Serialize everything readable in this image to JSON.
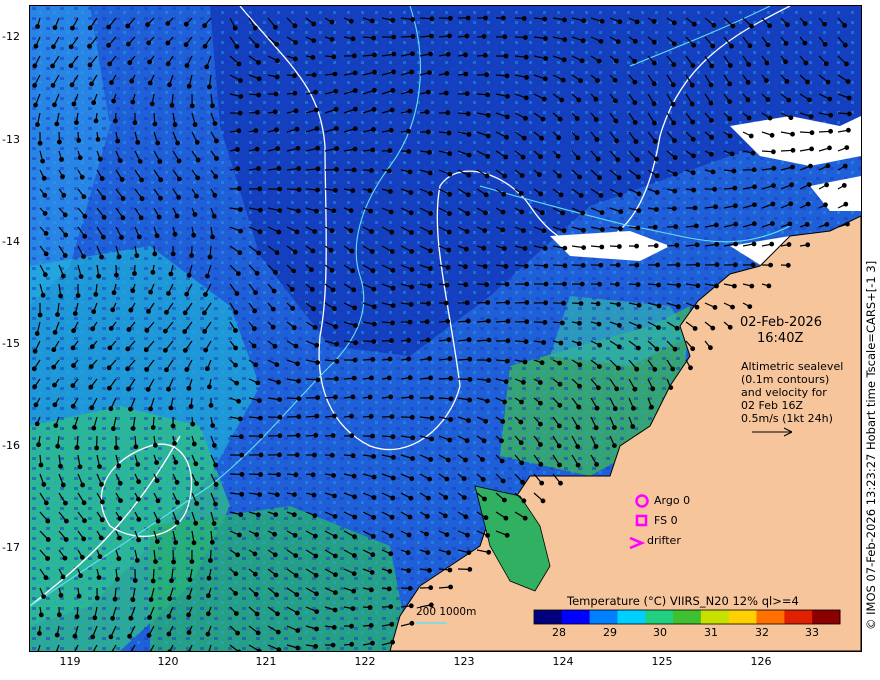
{
  "timestamp": {
    "date": "02-Feb-2026",
    "time": "16:40Z"
  },
  "altimetry_note": [
    "Altimetric sealevel",
    "(0.1m contours)",
    "and velocity for",
    "02 Feb 16Z",
    "0.5m/s (1kt 24h)"
  ],
  "credit": "© IMOS 07-Feb-2026 13:23:27 Hobart time Tscale=CARS+[-1 3]",
  "legend": {
    "title": "Temperature (°C) VIIRS_N20 12% ql>=4",
    "ticks": [
      "28",
      "29",
      "30",
      "31",
      "32",
      "33"
    ],
    "colors": [
      "#00007f",
      "#0000ff",
      "#0080ff",
      "#00d0ff",
      "#20d080",
      "#40c030",
      "#c8e000",
      "#ffd000",
      "#ff7000",
      "#e02000",
      "#8b0000"
    ]
  },
  "symbols": {
    "argo": "Argo 0",
    "fs": "FS 0",
    "drifter": "drifter",
    "marker_color": "#ff00ff"
  },
  "depth_contours": "200  1000m",
  "axes": {
    "lat_labels": [
      "-12",
      "-13",
      "-14",
      "-15",
      "-16",
      "-17"
    ],
    "lon_labels": [
      "119",
      "120",
      "121",
      "122",
      "123",
      "124",
      "125",
      "126"
    ]
  },
  "colors": {
    "land": "#f7c59c",
    "sea_base": "#1f5fd8",
    "sealevel_contour": "#ffffff",
    "bathymetry_contour": "#66e0f0",
    "velocity_arrow": "#000000"
  }
}
